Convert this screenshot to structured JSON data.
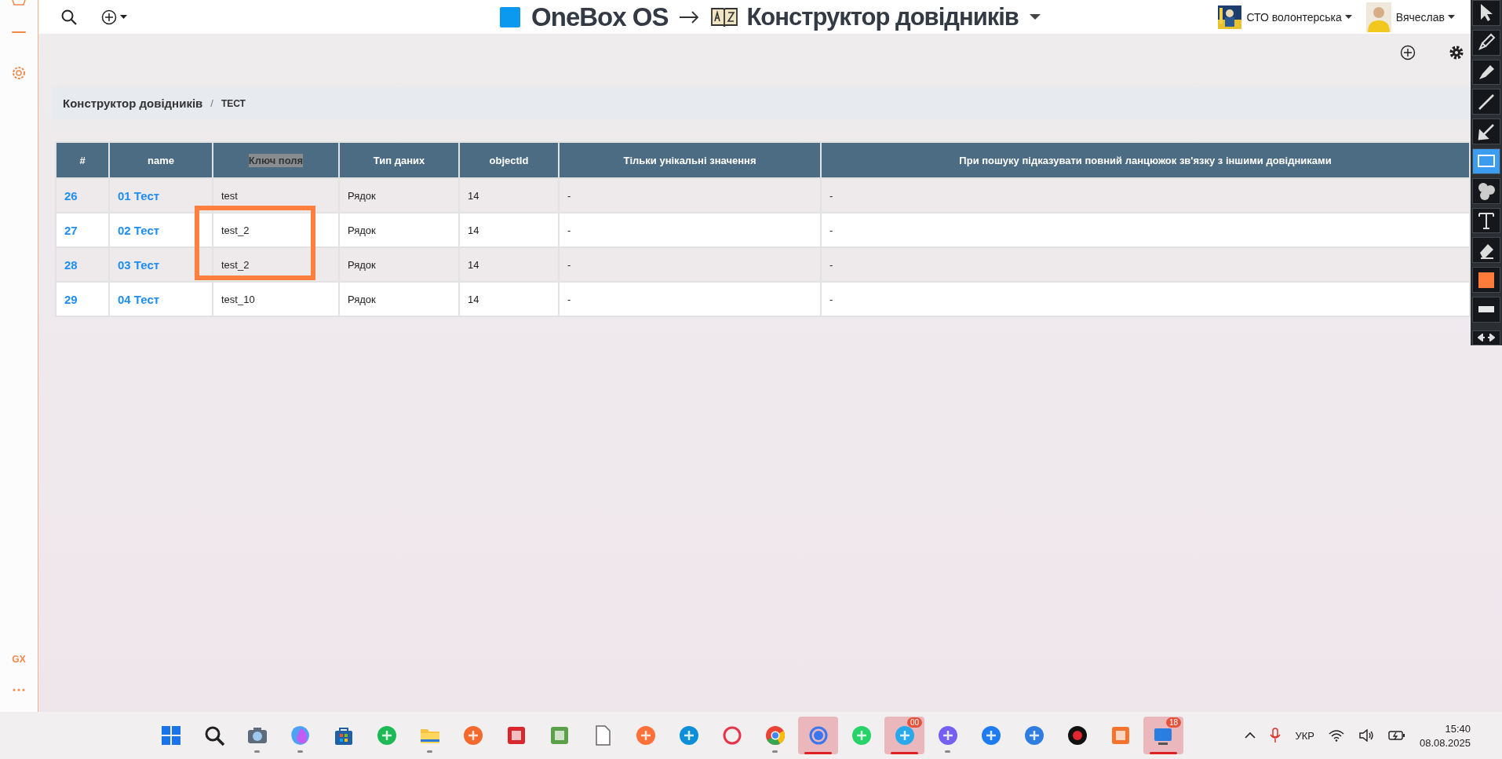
{
  "sidebar": {
    "badge": "GX"
  },
  "topbar": {
    "brand": "OneBox OS",
    "section": "Конструктор довідників",
    "organization": "СТО волонтерська",
    "user": "Вячеслав"
  },
  "breadcrumb": {
    "parent": "Конструктор довідників",
    "separator": "/",
    "current": "ТЕСТ"
  },
  "table": {
    "columns": [
      {
        "label": "#",
        "highlighted": false
      },
      {
        "label": "name",
        "highlighted": false
      },
      {
        "label": "Ключ поля",
        "highlighted": true
      },
      {
        "label": "Тип даних",
        "highlighted": false
      },
      {
        "label": "objectId",
        "highlighted": false
      },
      {
        "label": "Тільки унікальні значення",
        "highlighted": false
      },
      {
        "label": "При пошуку підказувати повний ланцюжок зв'язку з іншими довідниками",
        "highlighted": false
      }
    ],
    "rows": [
      [
        "26",
        "01 Тест",
        "test",
        "Рядок",
        "14",
        "-",
        "-"
      ],
      [
        "27",
        "02 Тест",
        "test_2",
        "Рядок",
        "14",
        "-",
        "-"
      ],
      [
        "28",
        "03 Тест",
        "test_2",
        "Рядок",
        "14",
        "-",
        "-"
      ],
      [
        "29",
        "04 Тест",
        "test_10",
        "Рядок",
        "14",
        "-",
        "-"
      ]
    ]
  },
  "annotation_tools": {
    "tools": [
      {
        "selected": false
      },
      {
        "selected": false
      },
      {
        "selected": false
      },
      {
        "selected": false
      },
      {
        "selected": false
      },
      {
        "selected": true
      },
      {
        "selected": false
      },
      {
        "selected": false
      },
      {
        "selected": false
      }
    ],
    "color": "#ff7b3a"
  },
  "taskbar": {
    "apps": [
      {
        "active": false,
        "running": false
      },
      {
        "active": false,
        "running": false
      },
      {
        "active": false,
        "running": true
      },
      {
        "active": false,
        "running": true
      },
      {
        "active": false,
        "running": false
      },
      {
        "active": false,
        "running": false
      },
      {
        "active": false,
        "running": true
      },
      {
        "active": false,
        "running": false
      },
      {
        "active": false,
        "running": false
      },
      {
        "active": false,
        "running": false
      },
      {
        "active": false,
        "running": false
      },
      {
        "active": false,
        "running": false
      },
      {
        "active": false,
        "running": false
      },
      {
        "active": false,
        "running": false
      },
      {
        "active": false,
        "running": true
      },
      {
        "active": true
      },
      {
        "active": false,
        "running": false
      },
      {
        "active": true,
        "badge": "00"
      },
      {
        "active": false,
        "running": true
      },
      {
        "active": false,
        "running": false
      },
      {
        "active": false,
        "running": false
      },
      {
        "active": false,
        "running": false
      },
      {
        "active": false,
        "running": false
      },
      {
        "active": true,
        "badge": "18"
      }
    ],
    "language": "УКР",
    "time": "15:40",
    "date": "08.08.2025"
  }
}
